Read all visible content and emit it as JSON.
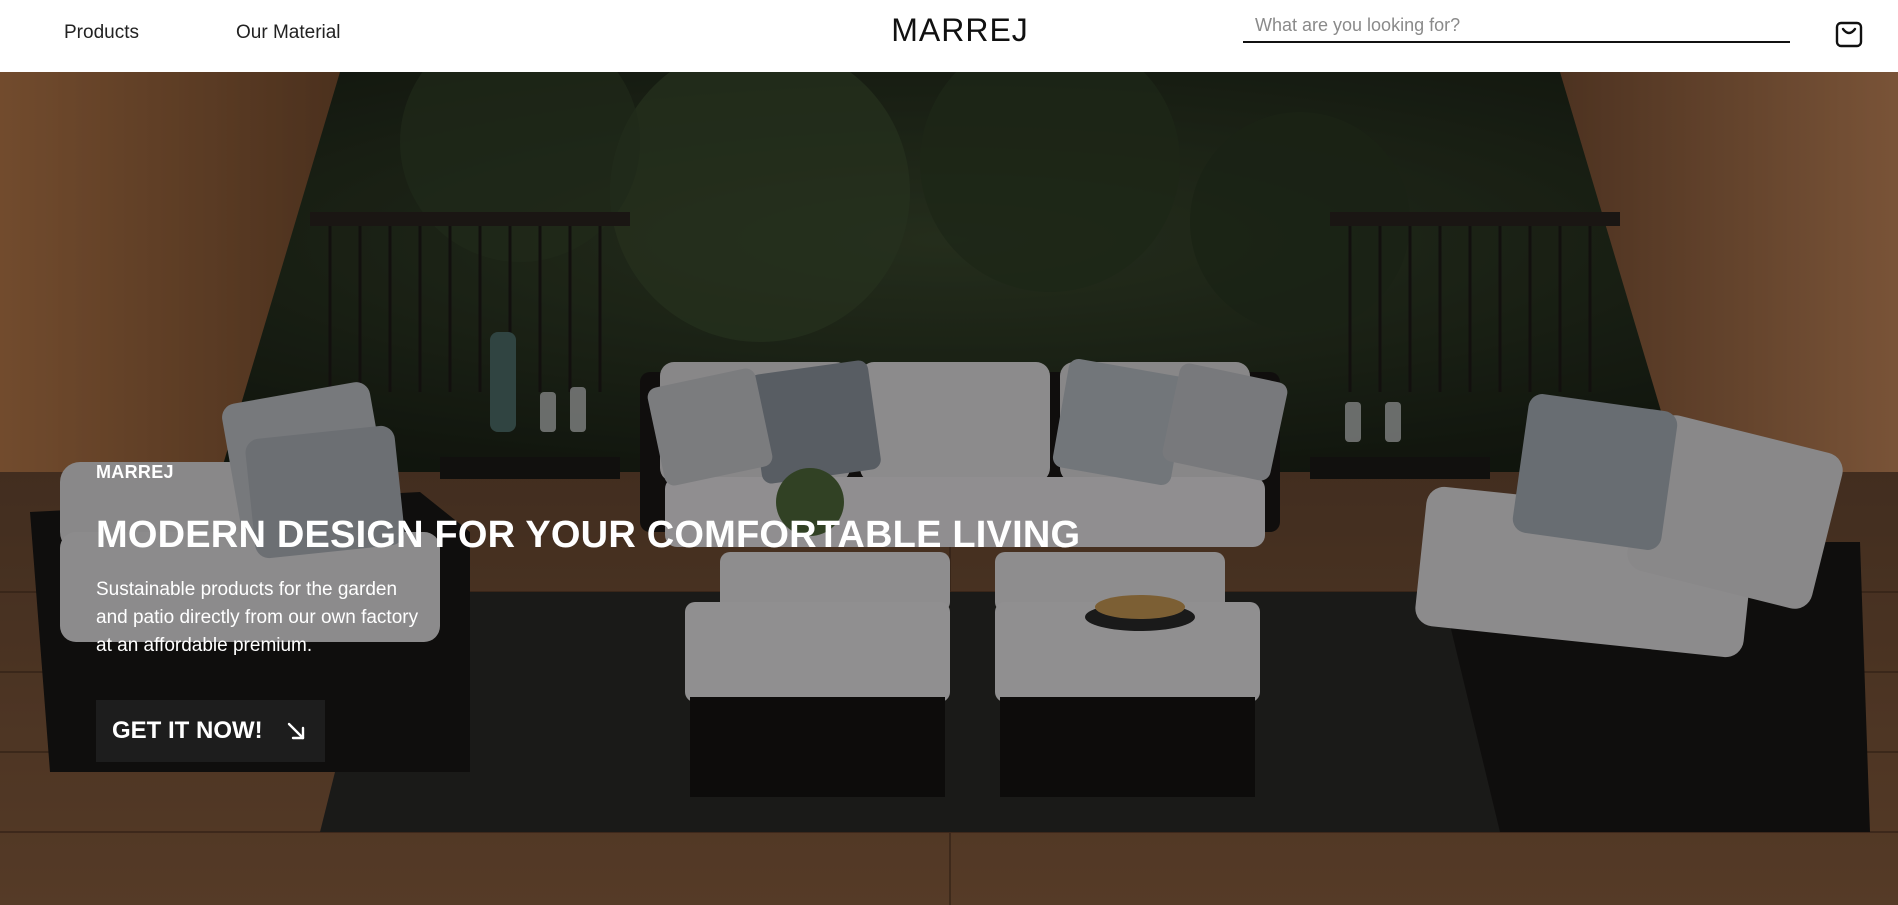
{
  "header": {
    "nav": [
      {
        "label": "Products"
      },
      {
        "label": "Our Material"
      }
    ],
    "brand": "MARREJ",
    "search": {
      "placeholder": "What are you looking for?",
      "value": ""
    },
    "cart_icon": "shopping-bag-icon"
  },
  "hero": {
    "background": "outdoor-patio-sofa-set-photo",
    "eyebrow": "MARREJ",
    "headline": "MODERN DESIGN FOR YOUR COMFORTABLE LIVING",
    "subtext": "Sustainable products for the garden and patio directly from our own factory at an affordable premium.",
    "cta_label": "GET IT NOW!",
    "cta_icon": "arrow-down-right-icon"
  },
  "colors": {
    "header_bg": "#ffffff",
    "cta_bg": "#1d1d1d",
    "text_light": "#ffffff"
  }
}
